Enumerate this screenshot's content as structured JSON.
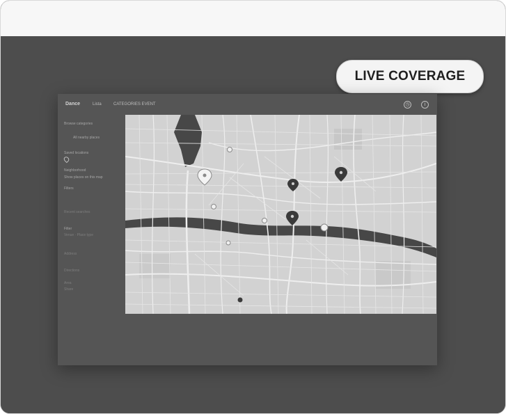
{
  "badge": {
    "label": "LIVE COVERAGE"
  },
  "app": {
    "brand": "Dance",
    "nav": [
      "Lista",
      "CATEGORIES EVENT"
    ],
    "header_icons": [
      "clock-icon",
      "info-icon"
    ]
  },
  "sidebar": {
    "items": [
      {
        "label": "Browse categories"
      },
      {
        "label": "All nearby places"
      },
      {
        "label": "Saved locations"
      },
      {
        "label": "Neighborhood"
      },
      {
        "label": "Show places on this map"
      },
      {
        "label": "Filters"
      },
      {
        "label": "Recent searches"
      },
      {
        "label": "Filter"
      },
      {
        "label": "Venue · Place type"
      },
      {
        "label": "Address"
      },
      {
        "label": "Directions"
      },
      {
        "label": "Area"
      },
      {
        "label": "Share"
      }
    ]
  },
  "map": {
    "pins": [
      {
        "kind": "light"
      },
      {
        "kind": "dark"
      },
      {
        "kind": "dark"
      },
      {
        "kind": "dark"
      },
      {
        "kind": "light"
      },
      {
        "kind": "light"
      },
      {
        "kind": "light"
      },
      {
        "kind": "light"
      },
      {
        "kind": "light"
      },
      {
        "kind": "dark"
      }
    ]
  },
  "colors": {
    "water": "#474747",
    "land": "#d2d2d2",
    "road": "#f2f2f2",
    "backdrop": "#4d4d4d"
  }
}
